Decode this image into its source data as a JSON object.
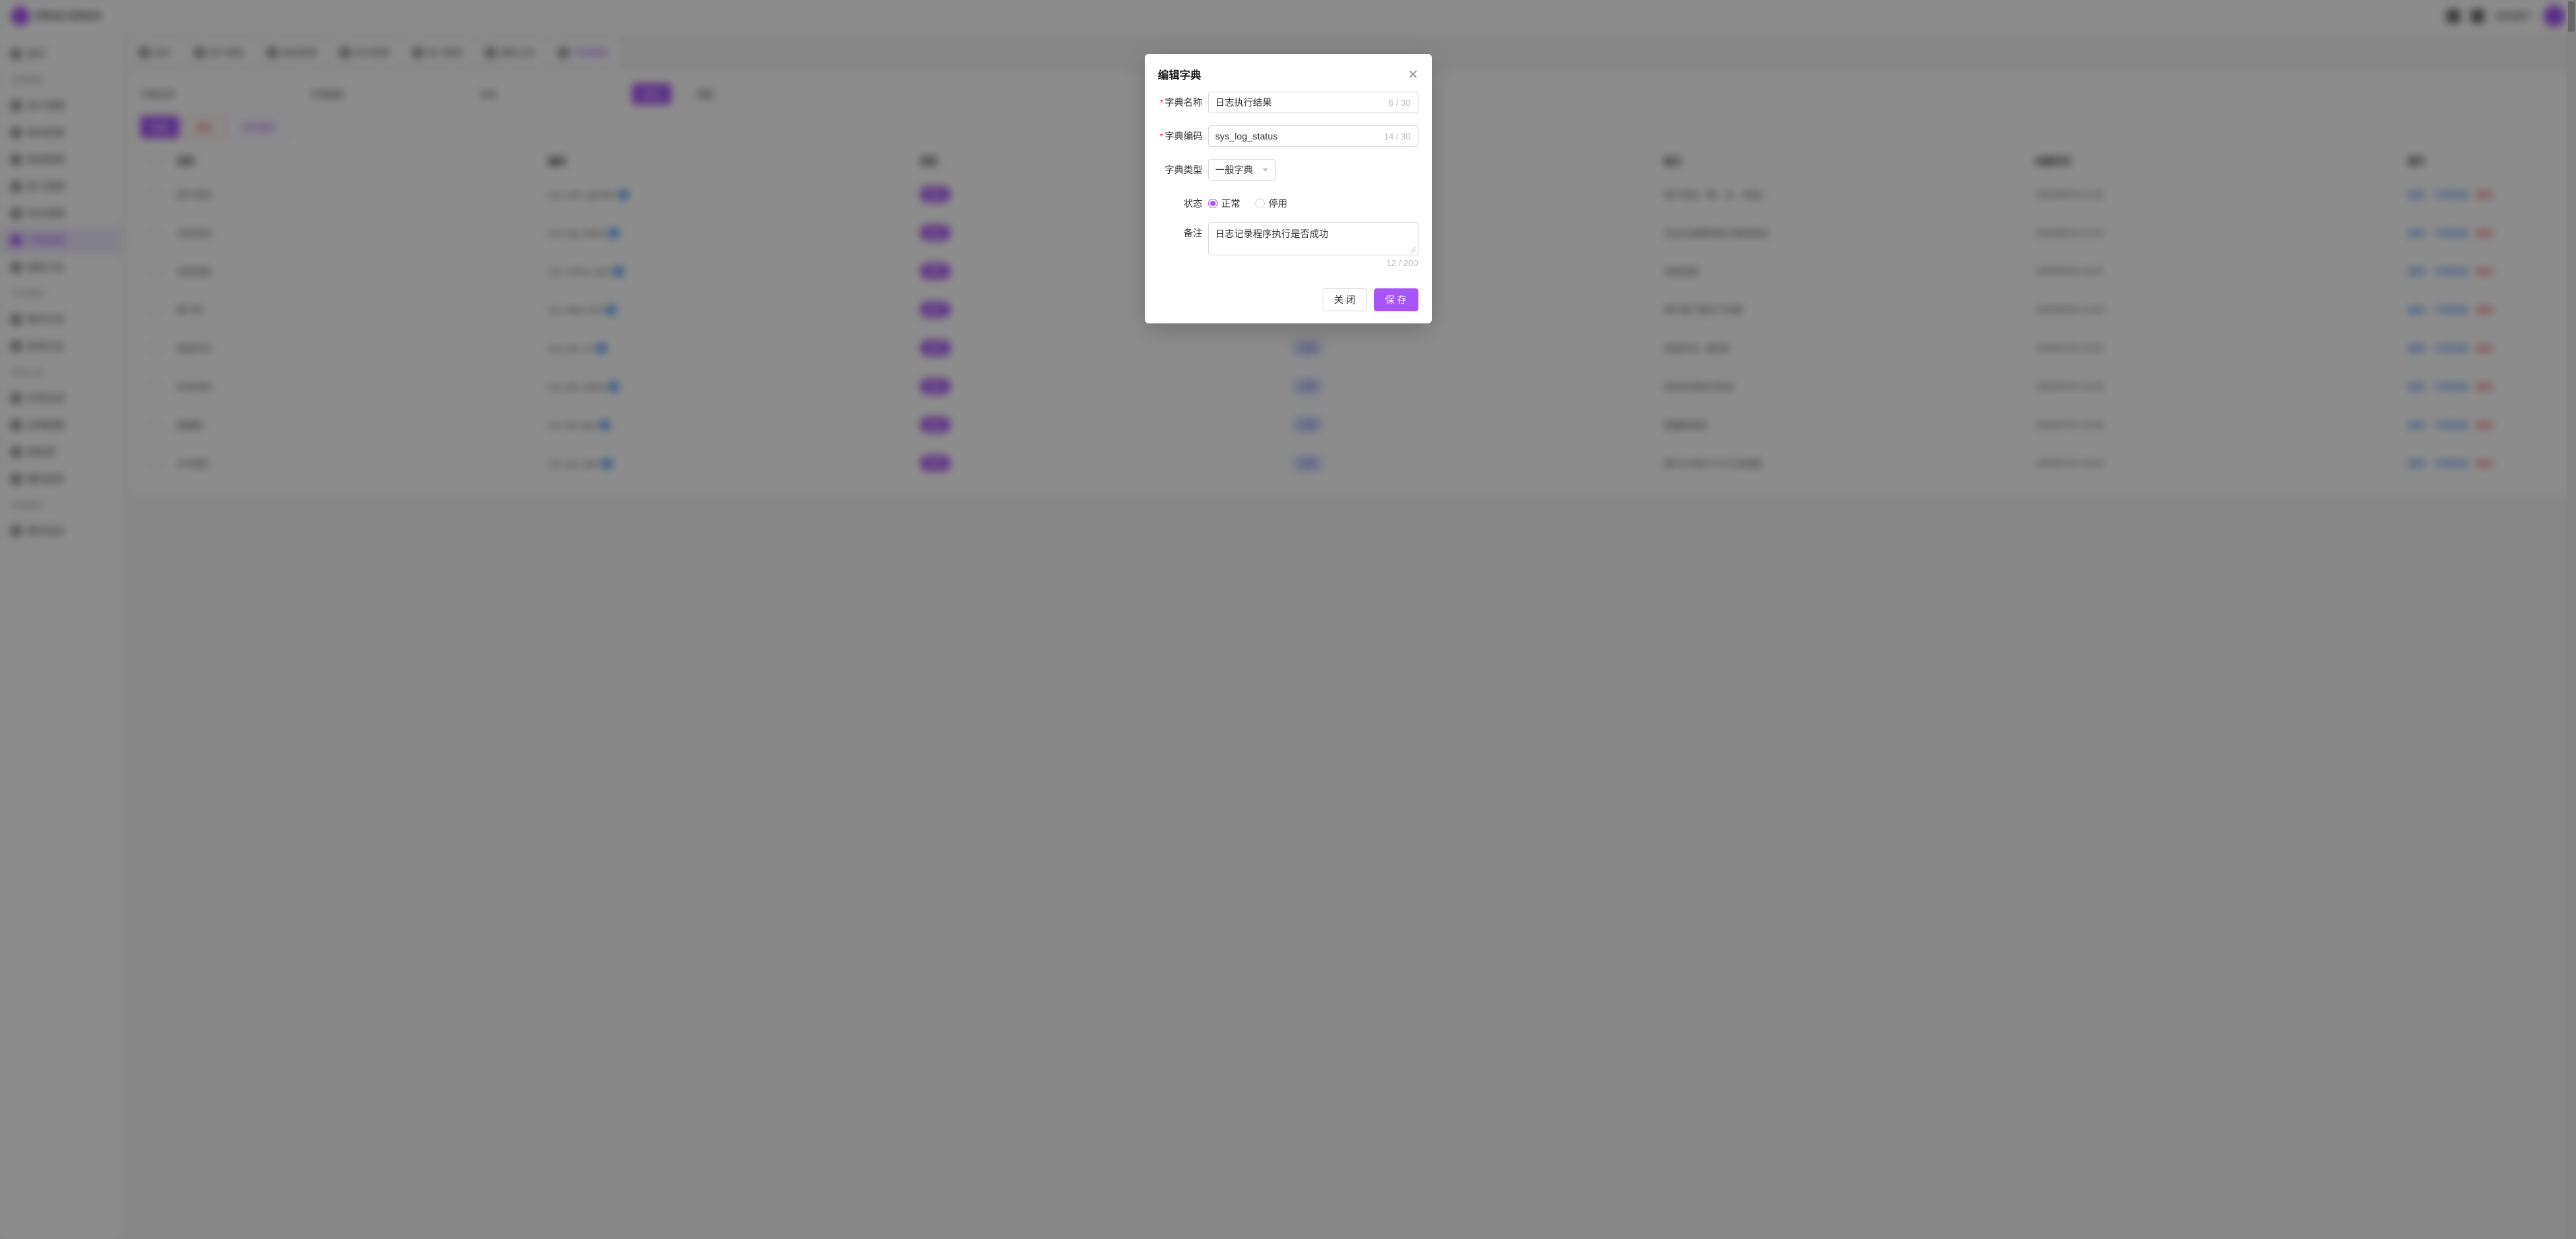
{
  "header": {
    "brand": "Ultras Admin",
    "username": "测试用户"
  },
  "sidebar": {
    "top_item": "首页",
    "groups": [
      {
        "label": "系统管理",
        "items": [
          "用户管理",
          "角色管理",
          "菜单管理",
          "部门管理",
          "岗位管理",
          "字典管理",
          "通知公告"
        ]
      },
      {
        "label": "日志管理",
        "items": [
          "操作日志",
          "登录日志"
        ]
      },
      {
        "label": "系统工具",
        "items": [
          "代码生成",
          "应用配置",
          "数据源",
          "缓存监控"
        ]
      },
      {
        "label": "系统监控",
        "items": [
          "服务监控"
        ]
      }
    ],
    "active": "字典管理"
  },
  "tabs": {
    "items": [
      "首页",
      "用户管理",
      "角色管理",
      "岗位管理",
      "部门管理",
      "通知公告",
      "字典管理"
    ],
    "active": "字典管理"
  },
  "filters": {
    "name_label": "字典名称",
    "name_placeholder": "请输入字典名称",
    "code_label": "字典编码",
    "code_placeholder": "请输入字典编码",
    "status_label": "状态",
    "search_btn": "查询",
    "reset_btn": "重置"
  },
  "toolbar": {
    "add": "新增",
    "delete": "删除",
    "import": "刷新缓存"
  },
  "table": {
    "cols": [
      "名称",
      "编码",
      "类型",
      "状态",
      "备注",
      "创建时间",
      "操作"
    ],
    "action_edit": "编辑",
    "action_data": "字典数据",
    "action_delete": "删除",
    "rows": [
      {
        "name": "用户性别",
        "code": "sys_user_gender",
        "type": "枚举",
        "status": "正常",
        "remark": "用户性别（男、女、未知）",
        "time": "2023/05/19 11:43"
      },
      {
        "name": "日志状态",
        "code": "sys_log_status",
        "type": "枚举",
        "status": "正常",
        "remark": "日志记录程序执行是否成功",
        "time": "2023/05/19 11:43"
      },
      {
        "name": "消息类型",
        "code": "sys_notice_type",
        "type": "枚举",
        "status": "正常",
        "remark": "消息类型",
        "time": "2023/05/20 10:07"
      },
      {
        "name": "部门树",
        "code": "sys_dept_tree",
        "type": "枚举",
        "status": "正常",
        "remark": "用于部门树形下拉框",
        "time": "2023/05/20 14:36"
      },
      {
        "name": "系统开关",
        "code": "sys_yes_no",
        "type": "枚举",
        "status": "正常",
        "remark": "系统开关（是/否）",
        "time": "2023/07/15 10:21"
      },
      {
        "name": "任务状态",
        "code": "sys_job_status",
        "type": "枚举",
        "status": "正常",
        "remark": "定时任务执行状态",
        "time": "2023/07/15 10:22"
      },
      {
        "name": "数据源",
        "code": "sys_db_type",
        "type": "枚举",
        "status": "正常",
        "remark": "数据库类型",
        "time": "2023/07/15 10:30"
      },
      {
        "name": "API类型",
        "code": "sys_api_type",
        "type": "枚举",
        "status": "正常",
        "remark": "接口API的HTTP方法类型",
        "time": "2023/07/15 10:34"
      }
    ]
  },
  "modal": {
    "title": "编辑字典",
    "fields": {
      "name_label": "字典名称",
      "name_value": "日志执行结果",
      "name_counter": "6 / 30",
      "code_label": "字典编码",
      "code_value": "sys_log_status",
      "code_counter": "14 / 30",
      "type_label": "字典类型",
      "type_value": "一般字典",
      "status_label": "状态",
      "status_normal": "正常",
      "status_disabled": "停用",
      "remark_label": "备注",
      "remark_value": "日志记录程序执行是否成功",
      "remark_counter": "12 / 200"
    },
    "footer": {
      "close": "关 闭",
      "save": "保 存"
    }
  }
}
